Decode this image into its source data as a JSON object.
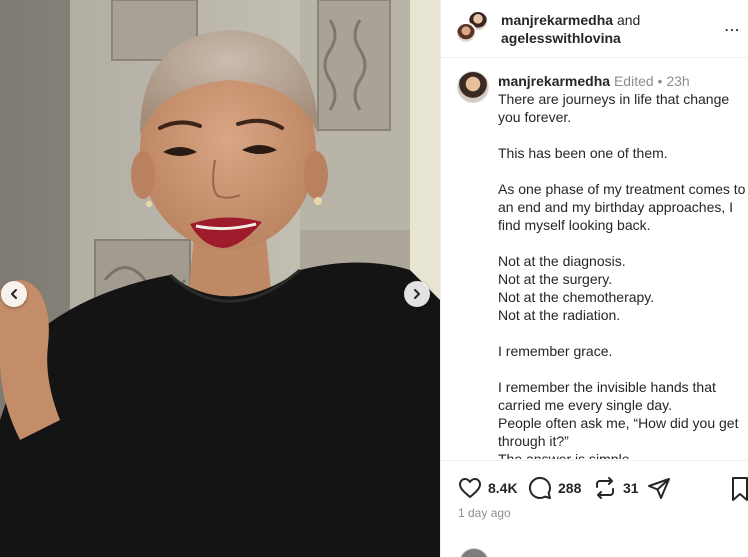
{
  "post": {
    "image_alt": "Smiling woman with a shaved head wearing a black top and red lipstick",
    "carousel": {
      "prev_icon": "chevron-left-icon",
      "next_icon": "chevron-right-icon"
    }
  },
  "header": {
    "user1": "manjrekarmedha",
    "conjunction": "and",
    "user2": "agelesswithlovina",
    "more_icon": "more-horizontal-icon"
  },
  "caption": {
    "username": "manjrekarmedha",
    "edited": "Edited",
    "dot": "•",
    "time": "23h",
    "lines": [
      "There are journeys in life that change",
      "you forever.",
      "",
      "This has been one of them.",
      "",
      "As one phase of my treatment comes to",
      "an end and my birthday approaches, I",
      "find myself looking back.",
      "",
      "Not at the diagnosis.",
      "Not at the surgery.",
      "Not at the chemotherapy.",
      "Not at the radiation.",
      "",
      "I remember grace.",
      "",
      "I remember the invisible hands that",
      "carried me every single day.",
      "People often ask me, “How did you get",
      "through it?”",
      "The answer is simple."
    ]
  },
  "actions": {
    "likes": "8.4K",
    "comments": "288",
    "reposts": "31",
    "like_icon": "heart-icon",
    "comment_icon": "comment-icon",
    "repost_icon": "repost-icon",
    "share_icon": "send-icon"
  },
  "footer": {
    "time_ago": "1 day ago"
  }
}
